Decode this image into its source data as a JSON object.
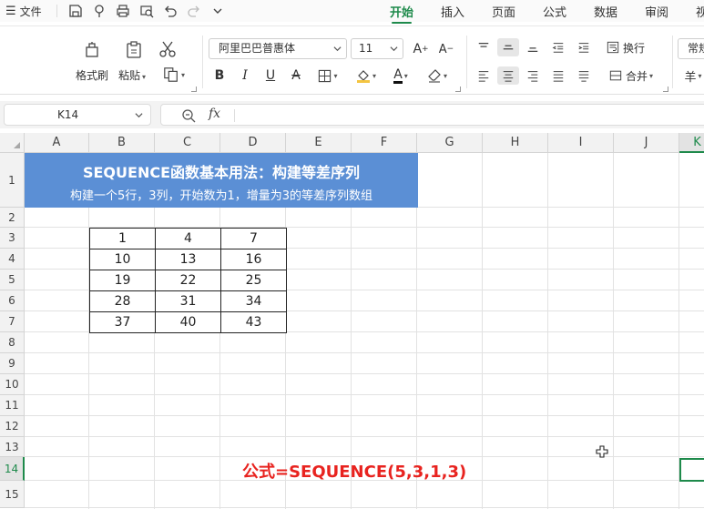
{
  "topbar": {
    "menu_label": "文件",
    "tabs": [
      {
        "label": "开始",
        "active": true
      },
      {
        "label": "插入",
        "active": false
      },
      {
        "label": "页面",
        "active": false
      },
      {
        "label": "公式",
        "active": false
      },
      {
        "label": "数据",
        "active": false
      },
      {
        "label": "审阅",
        "active": false
      },
      {
        "label": "视",
        "active": false
      }
    ],
    "quick_access_icons": [
      "save-icon",
      "format-painter-icon",
      "print-icon",
      "print-preview-icon",
      "undo-icon",
      "redo-icon",
      "more-icon"
    ]
  },
  "ribbon": {
    "format_painter_label": "格式刷",
    "paste_label": "粘贴",
    "font_name": "阿里巴巴普惠体",
    "font_size": "11",
    "wrap_label": "换行",
    "merge_label": "合并",
    "number_format": "常规",
    "currency_symbol": "羊"
  },
  "formula_bar": {
    "cell_ref": "K14",
    "fx_label": "fx",
    "content": ""
  },
  "sheet": {
    "columns": [
      "A",
      "B",
      "C",
      "D",
      "E",
      "F",
      "G",
      "H",
      "I",
      "J",
      "K"
    ],
    "rows": [
      "1",
      "2",
      "3",
      "4",
      "5",
      "6",
      "7",
      "8",
      "9",
      "10",
      "11",
      "12",
      "13",
      "14",
      "15"
    ],
    "selected_column": "K",
    "selected_row": "14",
    "banner_title": "SEQUENCE函数基本用法：构建等差序列",
    "banner_subtitle": "构建一个5行，3列，开始数为1，增量为3的等差序列数组",
    "banner_color": "#5b8fd5",
    "table": [
      [
        "1",
        "4",
        "7"
      ],
      [
        "10",
        "13",
        "16"
      ],
      [
        "19",
        "22",
        "25"
      ],
      [
        "28",
        "31",
        "34"
      ],
      [
        "37",
        "40",
        "43"
      ]
    ],
    "formula_note": "公式=SEQUENCE(5,3,1,3)",
    "formula_note_color": "#e8231f",
    "accent_color": "#1e8a4b"
  }
}
